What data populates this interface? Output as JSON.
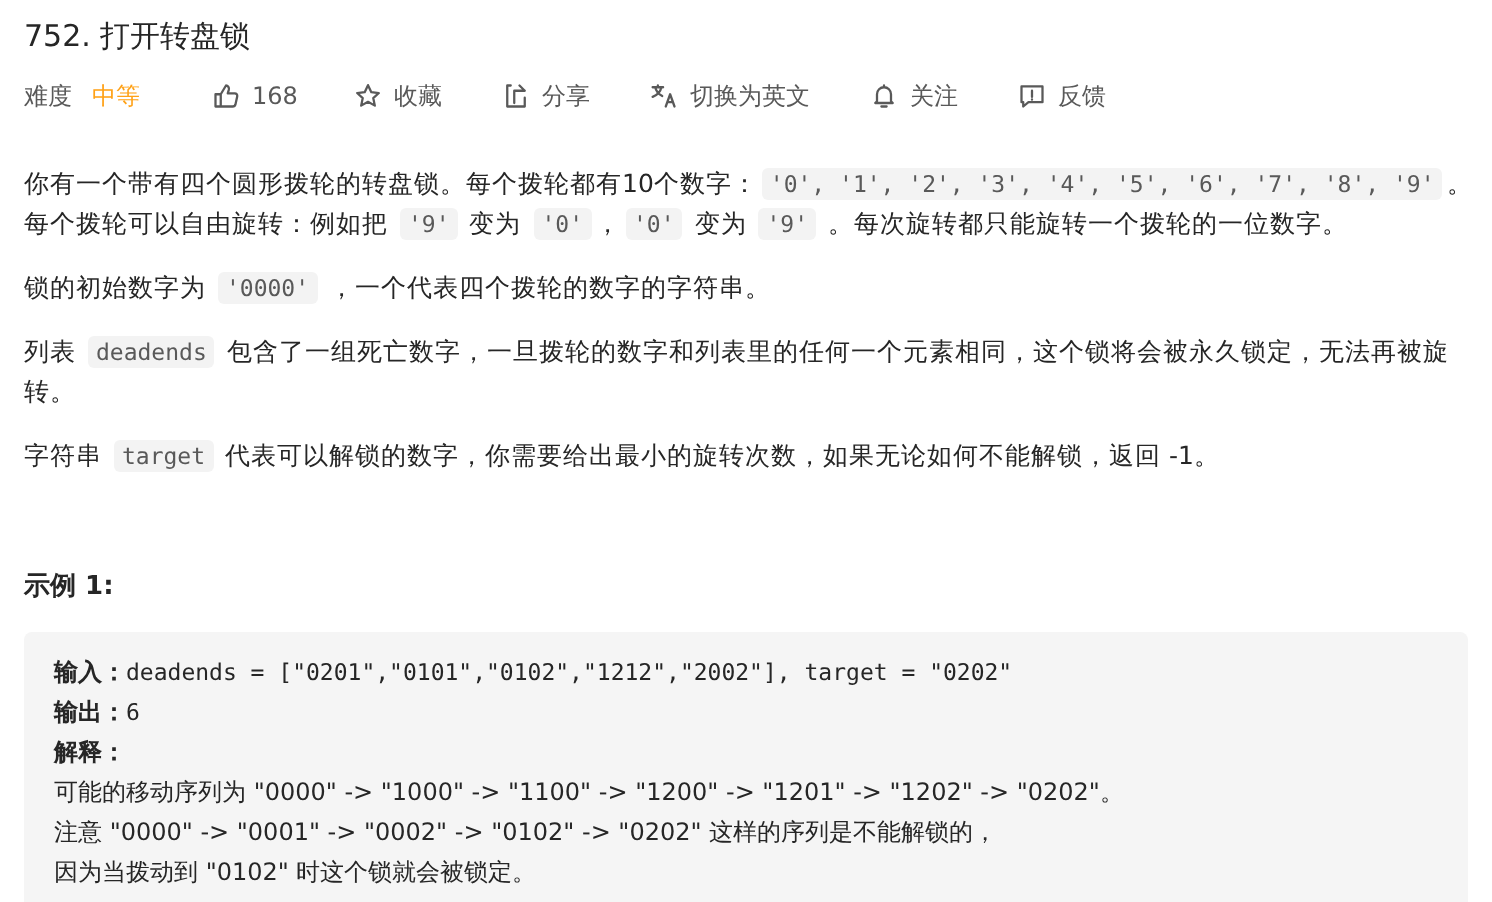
{
  "title": "752. 打开转盘锁",
  "difficulty": {
    "label": "难度",
    "value": "中等"
  },
  "actions": [
    {
      "label": "168"
    },
    {
      "label": "收藏"
    },
    {
      "label": "分享"
    },
    {
      "label": "切换为英文"
    },
    {
      "label": "关注"
    },
    {
      "label": "反馈"
    }
  ],
  "paragraphs": [
    [
      {
        "kind": "text",
        "text": "你有一个带有四个圆形拨轮的转盘锁。每个拨轮都有10个数字："
      },
      {
        "kind": "code",
        "text": "'0', '1', '2', '3', '4', '5', '6', '7', '8', '9'"
      },
      {
        "kind": "text",
        "text": "。每个拨轮可以自由旋转：例如把 "
      },
      {
        "kind": "code",
        "text": "'9'"
      },
      {
        "kind": "text",
        "text": " 变为 "
      },
      {
        "kind": "code",
        "text": "'0'"
      },
      {
        "kind": "text",
        "text": "，"
      },
      {
        "kind": "code",
        "text": "'0'"
      },
      {
        "kind": "text",
        "text": " 变为 "
      },
      {
        "kind": "code",
        "text": "'9'"
      },
      {
        "kind": "text",
        "text": " 。每次旋转都只能旋转一个拨轮的一位数字。"
      }
    ],
    [
      {
        "kind": "text",
        "text": "锁的初始数字为 "
      },
      {
        "kind": "code",
        "text": "'0000'"
      },
      {
        "kind": "text",
        "text": " ，一个代表四个拨轮的数字的字符串。"
      }
    ],
    [
      {
        "kind": "text",
        "text": "列表 "
      },
      {
        "kind": "code",
        "text": "deadends"
      },
      {
        "kind": "text",
        "text": " 包含了一组死亡数字，一旦拨轮的数字和列表里的任何一个元素相同，这个锁将会被永久锁定，无法再被旋转。"
      }
    ],
    [
      {
        "kind": "text",
        "text": "字符串 "
      },
      {
        "kind": "code",
        "text": "target"
      },
      {
        "kind": "text",
        "text": " 代表可以解锁的数字，你需要给出最小的旋转次数，如果无论如何不能解锁，返回 -1。"
      }
    ]
  ],
  "example": {
    "title": "示例 1:",
    "lines": [
      {
        "kind": "field",
        "label": "输入：",
        "value": "deadends = [\"0201\",\"0101\",\"0102\",\"1212\",\"2002\"], target = \"0202\""
      },
      {
        "kind": "field",
        "label": "输出：",
        "value": "6"
      },
      {
        "kind": "field",
        "label": "解释："
      },
      {
        "kind": "plain",
        "value": "可能的移动序列为 \"0000\" -> \"1000\" -> \"1100\" -> \"1200\" -> \"1201\" -> \"1202\" -> \"0202\"。"
      },
      {
        "kind": "plain",
        "value": "注意 \"0000\" -> \"0001\" -> \"0002\" -> \"0102\" -> \"0202\" 这样的序列是不能解锁的，"
      },
      {
        "kind": "plain",
        "value": "因为当拨动到 \"0102\" 时这个锁就会被锁定。"
      }
    ]
  }
}
